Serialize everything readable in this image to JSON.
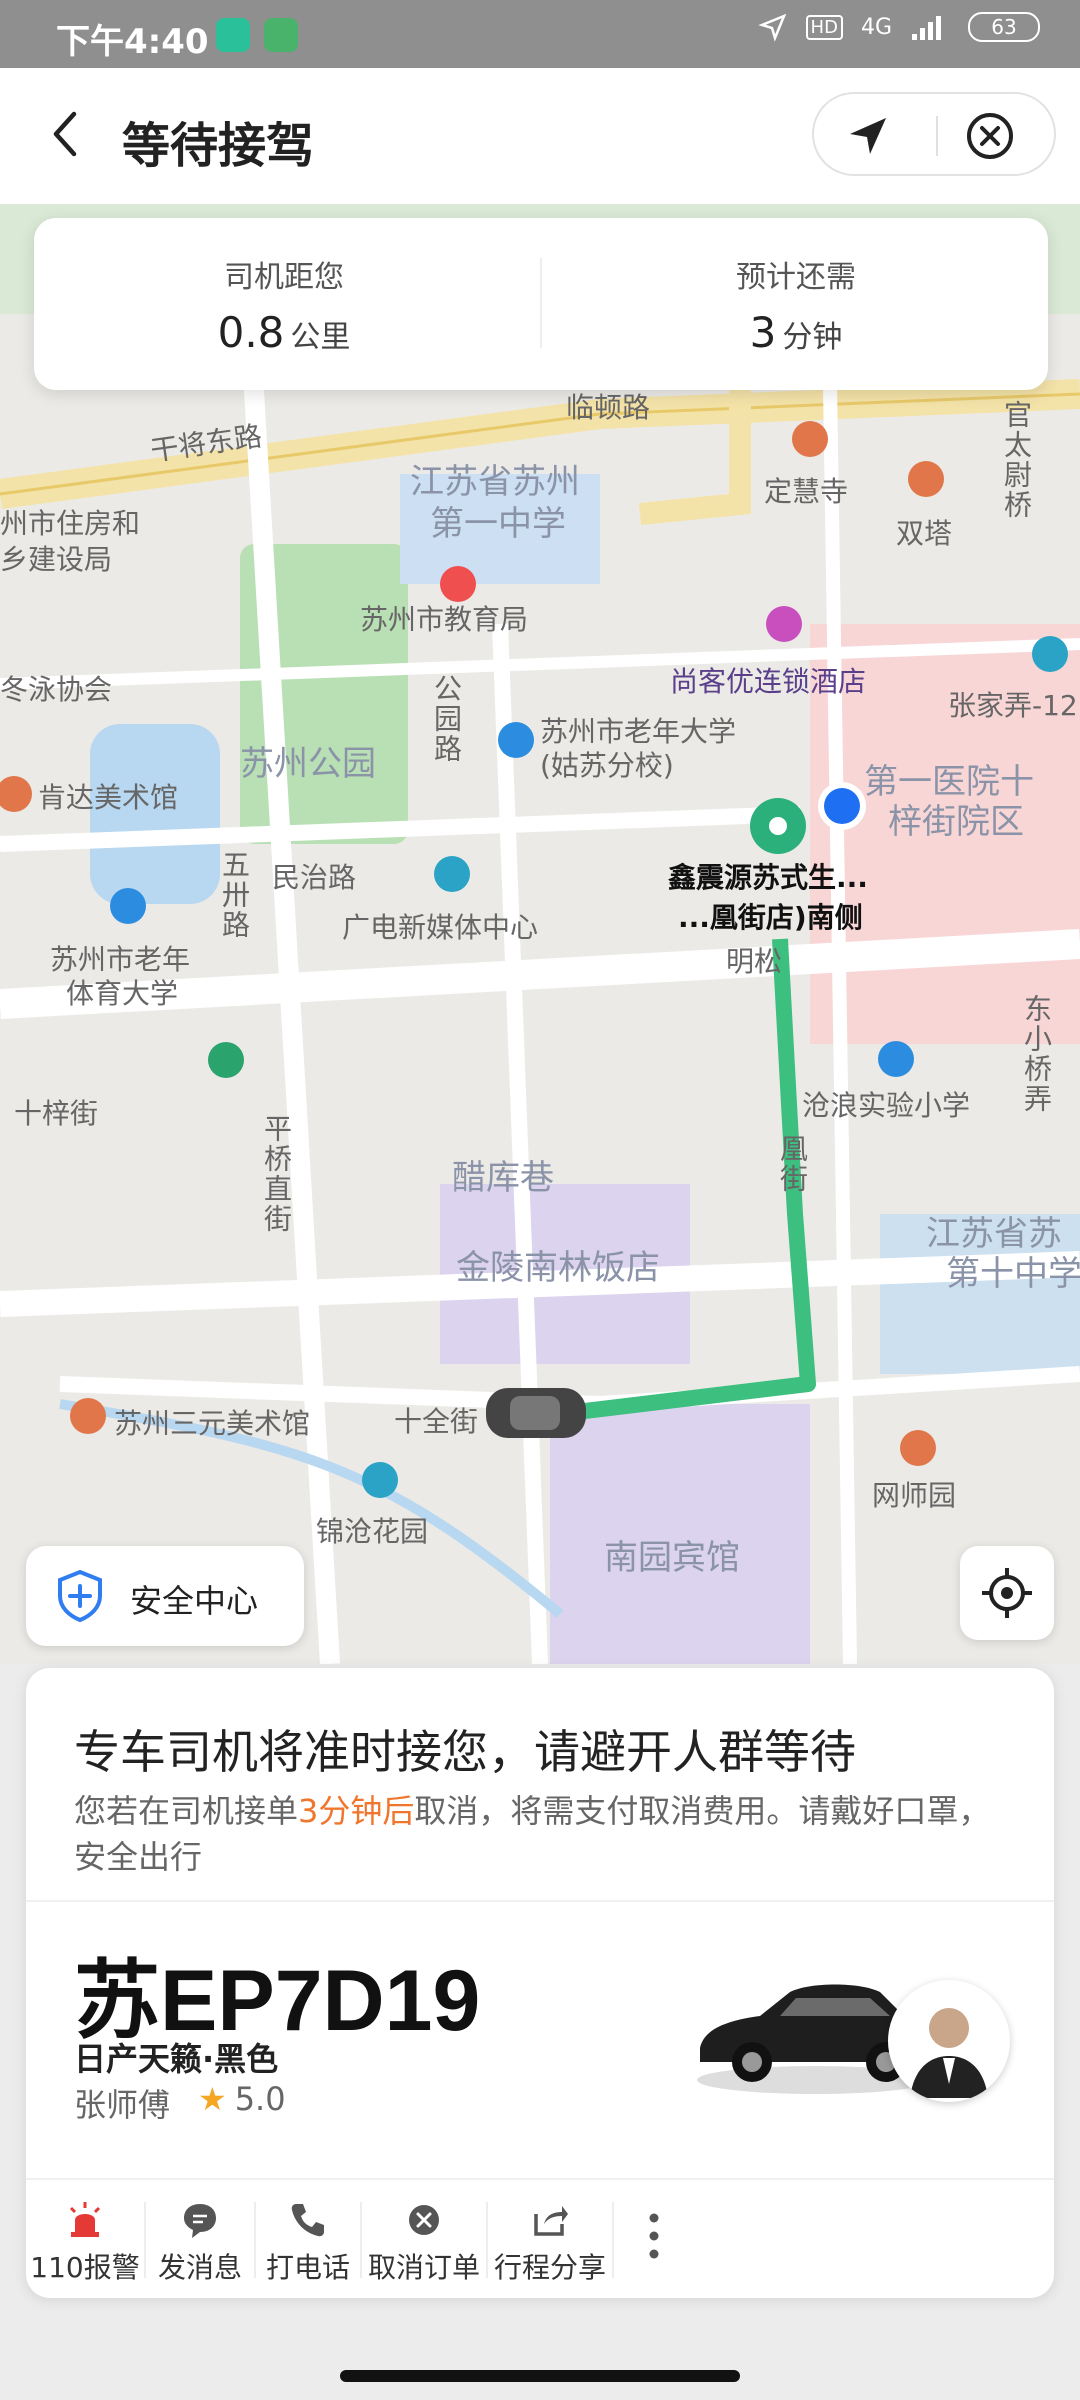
{
  "status_bar": {
    "time": "下午4:40",
    "network": "4G",
    "hd": "HD",
    "battery": "63"
  },
  "header": {
    "title": "等待接驾"
  },
  "eta_card": {
    "distance_label": "司机距您",
    "distance_value": "0.8",
    "distance_unit": "公里",
    "time_label": "预计还需",
    "time_value": "3",
    "time_unit": "分钟"
  },
  "map": {
    "labels": {
      "ganjiang": "干将东路",
      "lindun": "临顿路",
      "zhufang1": "州市住房和",
      "zhufang2": "乡建设局",
      "school1a": "江苏省苏州",
      "school1b": "第一中学",
      "dinghui": "定慧寺",
      "shuangta": "双塔",
      "guanta": "官太尉桥",
      "jiaoyu": "苏州市教育局",
      "dongyong": "冬泳协会",
      "shangke": "尚客优连锁酒店",
      "zhangjia": "张家弄-12",
      "gongyuan": "苏州公园",
      "gongyuanlu": "公园路",
      "laonian1": "苏州市老年大学",
      "laonian2": "(姑苏分校)",
      "hospital1": "第一医院十",
      "hospital2": "梓街院区",
      "kenda": "肯达美术馆",
      "pickup1": "鑫震源苏式生...",
      "pickup2": "...凰街店)南侧",
      "wuzhi": "五卅路",
      "minzhi": "民治路",
      "guangdian": "广电新媒体中心",
      "mingke": "明松",
      "tiyu1": "苏州市老年",
      "tiyu2": "体育大学",
      "dongxiao": "东小桥弄",
      "shizi": "十梓街",
      "canglang": "沧浪实验小学",
      "pingqiao": "平桥直街",
      "cuku": "醋库巷",
      "fenghuang": "凰街",
      "shiwu1": "江苏省苏",
      "shiwu2": "第十中学",
      "jinling": "金陵南林饭店",
      "sanyuan": "苏州三元美术馆",
      "shiquan": "十全街",
      "wangshi": "网师园",
      "jincang": "锦沧花园",
      "nanyuan": "南园宾馆"
    }
  },
  "safety": {
    "label": "安全中心"
  },
  "panel": {
    "notice_title": "专车司机将准时接您，请避开人群等待",
    "notice_pre": "您若在司机接单",
    "notice_highlight": "3分钟后",
    "notice_post": "取消，将需支付取消费用。请戴好口罩，安全出行",
    "plate": "苏EP7D19",
    "car_model": "日产天籁·黑色",
    "driver_name": "张师傅",
    "rating": "5.0"
  },
  "actions": [
    {
      "label": "110报警",
      "icon": "alarm-icon",
      "color": "#e53935"
    },
    {
      "label": "发消息",
      "icon": "message-icon",
      "color": "#555555"
    },
    {
      "label": "打电话",
      "icon": "phone-icon",
      "color": "#555555"
    },
    {
      "label": "取消订单",
      "icon": "cancel-icon",
      "color": "#555555"
    },
    {
      "label": "行程分享",
      "icon": "share-icon",
      "color": "#555555"
    }
  ],
  "colors": {
    "route": "#3dbf7f",
    "pickup_pin": "#2bb07b",
    "user_dot": "#1e6ff2",
    "highlight": "#f0752d"
  }
}
